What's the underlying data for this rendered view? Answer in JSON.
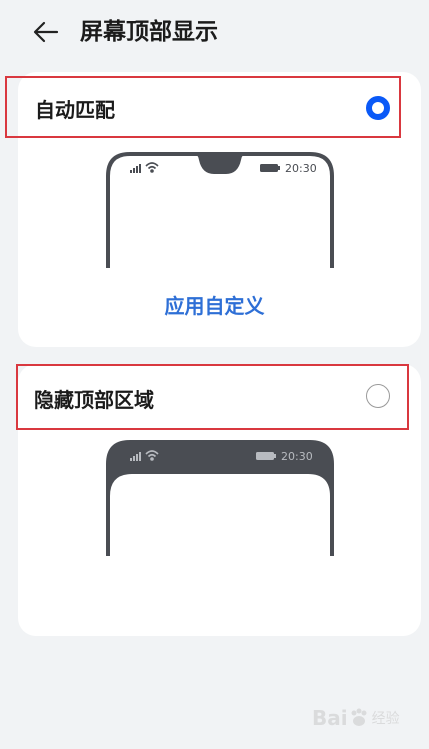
{
  "header": {
    "title": "屏幕顶部显示",
    "back_icon": "arrow-left-icon"
  },
  "options": [
    {
      "label": "自动匹配",
      "selected": true
    },
    {
      "label": "隐藏顶部区域",
      "selected": false
    }
  ],
  "preview": {
    "time": "20:30"
  },
  "custom_link": "应用自定义",
  "watermark": {
    "brand": "Bai",
    "sub": "经验"
  },
  "colors": {
    "accent": "#0a59f7",
    "link": "#2e6fd6",
    "highlight_box": "#d9383f",
    "background": "#f1f3f5",
    "card": "#ffffff",
    "phone_frame": "#4a4d53"
  }
}
